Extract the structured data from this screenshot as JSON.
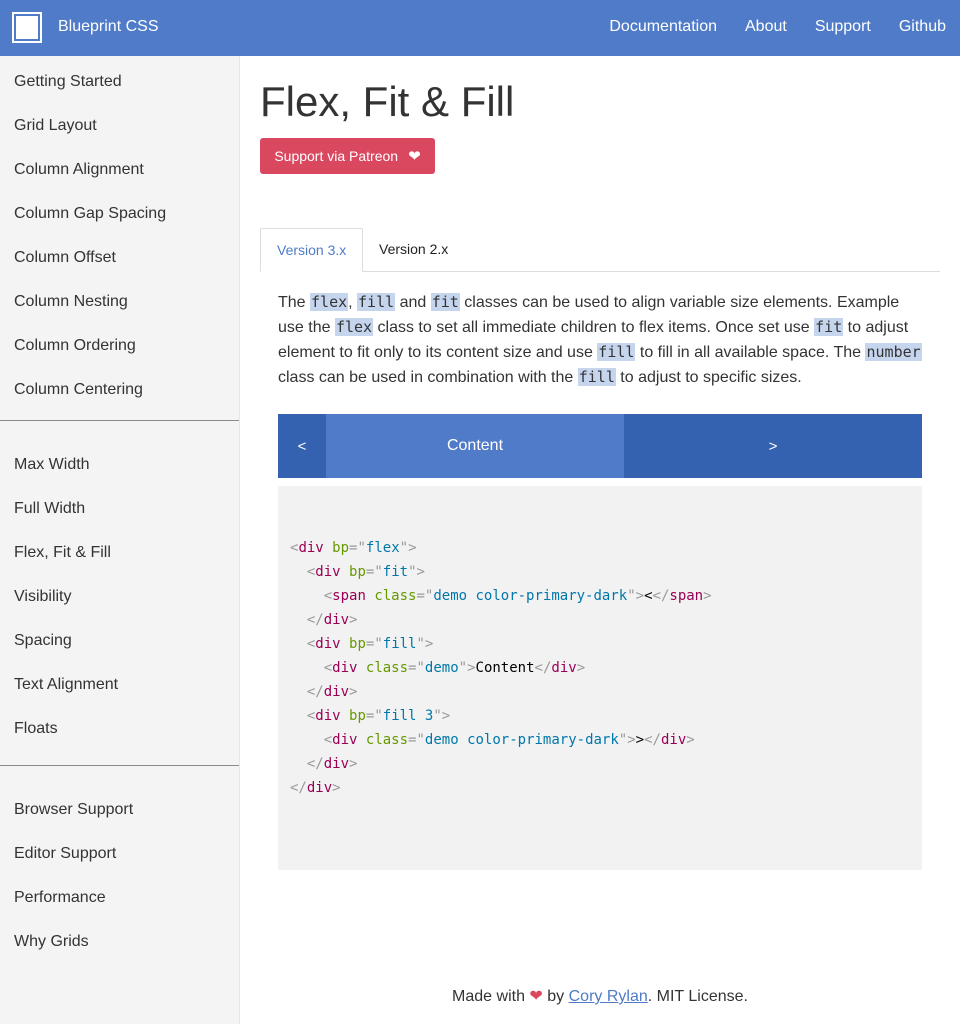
{
  "header": {
    "brand": "Blueprint CSS",
    "nav": [
      "Documentation",
      "About",
      "Support",
      "Github"
    ]
  },
  "sidebar": {
    "group1": [
      "Getting Started",
      "Grid Layout",
      "Column Alignment",
      "Column Gap Spacing",
      "Column Offset",
      "Column Nesting",
      "Column Ordering",
      "Column Centering"
    ],
    "group2": [
      "Max Width",
      "Full Width",
      "Flex, Fit & Fill",
      "Visibility",
      "Spacing",
      "Text Alignment",
      "Floats"
    ],
    "group3": [
      "Browser Support",
      "Editor Support",
      "Performance",
      "Why Grids"
    ]
  },
  "page": {
    "title": "Flex, Fit & Fill",
    "patreon_label": "Support via Patreon",
    "tabs": [
      "Version 3.x",
      "Version 2.x"
    ],
    "desc": {
      "t1": "The ",
      "k1": "flex",
      "t2": ", ",
      "k2": "fill",
      "t3": " and ",
      "k3": "fit",
      "t4": " classes can be used to align variable size elements. Example use the ",
      "k4": "flex",
      "t5": " class to set all immediate children to flex items. Once set use ",
      "k5": "fit",
      "t6": " to adjust element to fit only to its content size and use ",
      "k6": "fill",
      "t7": " to fill in all available space. The ",
      "k7": "number",
      "t8": " class can be used in combination with the ",
      "k8": "fill",
      "t9": " to adjust to specific sizes."
    },
    "demo": {
      "left": "<",
      "middle": "Content",
      "right": ">"
    },
    "footer": {
      "made_with": "Made with",
      "by": " by ",
      "author": "Cory Rylan",
      "license": ". MIT License."
    }
  },
  "colors": {
    "primary": "#4f7bc8",
    "primary_dark": "#3562b0",
    "patreon": "#d9485f"
  }
}
